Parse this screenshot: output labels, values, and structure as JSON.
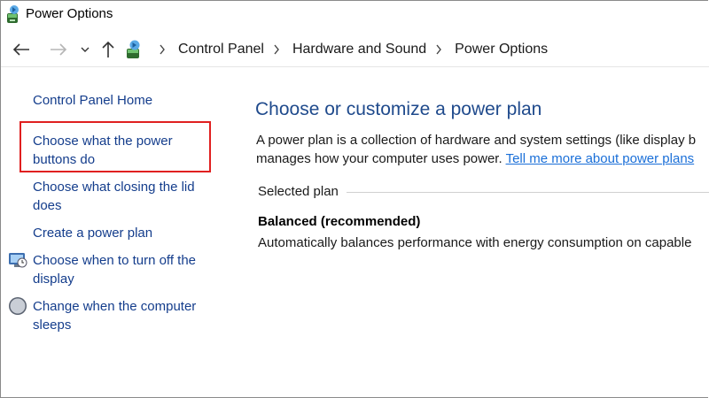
{
  "window": {
    "title": "Power Options"
  },
  "nav": {
    "breadcrumb": [
      "Control Panel",
      "Hardware and Sound",
      "Power Options"
    ]
  },
  "sidebar": {
    "home": "Control Panel Home",
    "items": [
      "Choose what the power buttons do",
      "Choose what closing the lid does",
      "Create a power plan",
      "Choose when to turn off the display",
      "Change when the computer sleeps"
    ]
  },
  "main": {
    "heading": "Choose or customize a power plan",
    "desc_line1": "A power plan is a collection of hardware and system settings (like display b",
    "desc_line2_prefix": "manages how your computer uses power.",
    "desc_link": "Tell me more about power plans",
    "selected_plan_label": "Selected plan",
    "plan_name": "Balanced (recommended)",
    "plan_desc": "Automatically balances performance with energy consumption on capable"
  },
  "icons": {
    "app": "power-options-icon",
    "back": "arrow-left-icon",
    "forward": "arrow-right-icon",
    "recent": "chevron-down-icon",
    "up": "arrow-up-icon",
    "separator": "chevron-right-icon",
    "display": "monitor-clock-icon",
    "sleep": "moon-icon"
  },
  "colors": {
    "link": "#143d8c",
    "heading": "#1f4a8c",
    "inline_link": "#1a6fd8",
    "highlight": "#e02020"
  }
}
